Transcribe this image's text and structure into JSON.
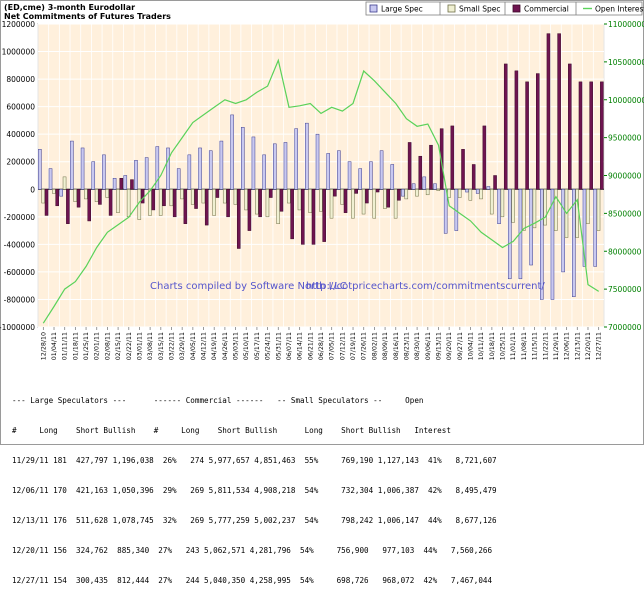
{
  "chart_data": {
    "type": "bar",
    "title": "(ED,cme) 3-month Eurodollar",
    "subtitle": "Net Commitments of Futures Traders",
    "watermark_line1": "Charts compiled by Software North LLC",
    "watermark_line2": "http://cotpricecharts.com/commitmentscurrent/",
    "legend": [
      "Large Spec",
      "Small Spec",
      "Commercial",
      "Open Interest"
    ],
    "legend_placement": "top",
    "colors": {
      "large_spec": "#c8c8f0",
      "large_spec_border": "#3a3a8c",
      "small_spec": "#f0f0d2",
      "small_spec_border": "#6e6e46",
      "commercial": "#6e1450",
      "commercial_border": "#3c0a28",
      "open_interest": "#5ad25a",
      "plot_bg": "#fff0dc",
      "grid": "#ffffff",
      "axis_left": "#000000",
      "axis_right": "#008000"
    },
    "grid": true,
    "ylim_left": [
      -1000000,
      1200000
    ],
    "ylim_right": [
      7000000,
      11000000
    ],
    "yticks_left": [
      "1200000",
      "1000000",
      "800000",
      "600000",
      "400000",
      "200000",
      "0",
      "-200000",
      "-400000",
      "-600000",
      "-800000",
      "-1000000"
    ],
    "yticks_right": [
      "11000000",
      "10500000",
      "10000000",
      "9500000",
      "9000000",
      "8500000",
      "8000000",
      "7500000",
      "7000000"
    ],
    "x": [
      "12/28/10",
      "01/04/11",
      "01/11/11",
      "01/18/11",
      "01/25/11",
      "02/01/11",
      "02/08/11",
      "02/15/11",
      "02/22/11",
      "03/01/11",
      "03/08/11",
      "03/15/11",
      "03/22/11",
      "03/29/11",
      "04/05/11",
      "04/12/11",
      "04/19/11",
      "04/26/11",
      "05/03/11",
      "05/10/11",
      "05/17/11",
      "05/24/11",
      "05/31/11",
      "06/07/11",
      "06/14/11",
      "06/21/11",
      "06/28/11",
      "07/05/11",
      "07/12/11",
      "07/19/11",
      "07/26/11",
      "08/02/11",
      "08/09/11",
      "08/16/11",
      "08/23/11",
      "08/30/11",
      "09/06/11",
      "09/13/11",
      "09/20/11",
      "09/27/11",
      "10/04/11",
      "10/11/11",
      "10/18/11",
      "10/25/11",
      "11/01/11",
      "11/08/11",
      "11/15/11",
      "11/22/11",
      "11/29/11",
      "12/06/11",
      "12/13/11",
      "12/20/11",
      "12/27/11"
    ],
    "xtick_labels": [
      "12/28/10",
      "01/04/11",
      "01/11/11",
      "01/18/11",
      "01/25/11",
      "02/01/11",
      "02/08/11",
      "02/15/11",
      "02/22/11",
      "03/01/11",
      "03/08/11",
      "03/15/11",
      "03/22/11",
      "03/29/11",
      "04/05/11",
      "04/12/11",
      "04/19/11",
      "04/26/11",
      "05/03/11",
      "05/10/11",
      "05/17/11",
      "05/24/11",
      "05/31/11",
      "06/07/11",
      "06/14/11",
      "06/21/11",
      "06/28/11",
      "07/05/11",
      "07/12/11",
      "07/19/11",
      "07/26/11",
      "08/02/11",
      "08/09/11",
      "08/16/11",
      "08/23/11",
      "08/30/11",
      "09/06/11",
      "09/13/11",
      "09/20/11",
      "09/27/11",
      "10/04/11",
      "10/11/11",
      "10/18/11",
      "10/25/11",
      "11/01/11",
      "11/08/11",
      "11/15/11",
      "11/22/11",
      "11/29/11",
      "12/06/11",
      "12/13/11",
      "12/20/11",
      "12/27/11"
    ],
    "series": [
      {
        "name": "Large Spec",
        "values": [
          290000,
          150000,
          -50000,
          350000,
          300000,
          200000,
          250000,
          80000,
          100000,
          210000,
          230000,
          310000,
          300000,
          150000,
          250000,
          300000,
          280000,
          350000,
          540000,
          450000,
          380000,
          250000,
          330000,
          340000,
          440000,
          480000,
          400000,
          260000,
          280000,
          200000,
          150000,
          200000,
          280000,
          180000,
          -50000,
          40000,
          90000,
          40000,
          -320000,
          -300000,
          -20000,
          -30000,
          20000,
          -250000,
          -650000,
          -650000,
          -550000,
          -800000,
          -800000,
          -600000,
          -780000,
          -560000,
          -560000
        ]
      },
      {
        "name": "Small Spec",
        "values": [
          -100000,
          -30000,
          90000,
          -90000,
          -70000,
          -90000,
          -60000,
          -170000,
          -200000,
          -220000,
          -190000,
          -190000,
          -120000,
          -70000,
          -110000,
          -100000,
          -190000,
          -100000,
          -110000,
          -150000,
          -180000,
          -200000,
          -250000,
          -100000,
          -150000,
          -170000,
          -160000,
          -210000,
          -110000,
          -210000,
          -180000,
          -210000,
          -140000,
          -210000,
          -70000,
          -50000,
          -40000,
          -10000,
          -60000,
          -60000,
          -80000,
          -70000,
          -180000,
          -200000,
          -240000,
          -300000,
          -280000,
          -260000,
          -300000,
          -350000,
          -350000,
          -250000,
          -300000
        ]
      },
      {
        "name": "Commercial",
        "values": [
          -190000,
          -120000,
          -250000,
          -130000,
          -230000,
          -110000,
          -190000,
          80000,
          70000,
          -100000,
          -150000,
          -120000,
          -200000,
          -250000,
          -140000,
          -260000,
          -60000,
          -200000,
          -430000,
          -300000,
          -200000,
          -60000,
          -160000,
          -360000,
          -400000,
          -400000,
          -380000,
          -50000,
          -170000,
          -30000,
          -100000,
          -20000,
          -130000,
          -80000,
          340000,
          240000,
          320000,
          440000,
          460000,
          290000,
          180000,
          460000,
          100000,
          910000,
          860000,
          780000,
          840000,
          1130000,
          1130000,
          910000,
          780000,
          780000,
          780000
        ]
      },
      {
        "name": "Open Interest",
        "values": [
          7050000,
          7270000,
          7500000,
          7600000,
          7800000,
          8050000,
          8250000,
          8350000,
          8450000,
          8650000,
          8800000,
          9000000,
          9300000,
          9500000,
          9700000,
          9800000,
          9900000,
          10000000,
          9950000,
          10000000,
          10100000,
          10180000,
          10520000,
          9900000,
          9920000,
          9950000,
          9820000,
          9900000,
          9850000,
          9950000,
          10380000,
          10250000,
          10100000,
          9950000,
          9750000,
          9650000,
          9680000,
          9400000,
          8600000,
          8500000,
          8400000,
          8250000,
          8150000,
          8050000,
          8130000,
          8300000,
          8370000,
          8450000,
          8720000,
          8500000,
          8680000,
          7560000,
          7470000
        ]
      }
    ]
  },
  "table": {
    "header1": "--- Large Speculators ---      ------ Commercial ------   -- Small Speculators --     Open",
    "header2": "#     Long    Short Bullish    #     Long    Short Bullish      Long    Short Bullish   Interest",
    "rows": [
      "11/29/11 181  427,797 1,196,038  26%   274 5,977,657 4,851,463  55%     769,190 1,127,143  41%   8,721,607",
      "12/06/11 170  421,163 1,050,396  29%   269 5,811,534 4,908,218  54%     732,304 1,006,387  42%   8,495,479",
      "12/13/11 176  511,628 1,078,745  32%   269 5,777,259 5,002,237  54%     798,242 1,006,147  44%   8,677,126",
      "12/20/11 156  324,762  885,340  27%   243 5,062,571 4,281,796  54%     756,900   977,103  44%   7,560,266",
      "12/27/11 154  300,435  812,444  27%   244 5,040,350 4,258,995  54%     698,726   968,072  42%   7,467,044"
    ]
  }
}
